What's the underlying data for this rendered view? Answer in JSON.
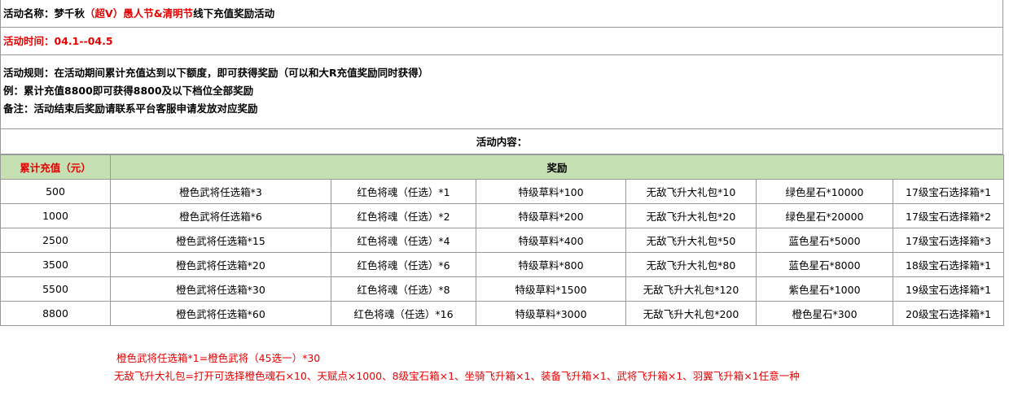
{
  "header": {
    "name_prefix": "活动名称：梦千秋",
    "name_highlight": "（超V）愚人节&清明节",
    "name_suffix": "线下充值奖励活动",
    "time": "活动时间：04.1--04.5"
  },
  "rules": {
    "line1": "活动规则：在活动期间累计充值达到以下额度，即可获得奖励（可以和大R充值奖励同时获得）",
    "line2": "例：累计充值8800即可获得8800及以下档位全部奖励",
    "line3": "备注：活动结束后奖励请联系平台客服申请发放对应奖励"
  },
  "content_label": "活动内容：",
  "table": {
    "col_amount": "累计充值（元）",
    "col_reward": "奖励",
    "rows": [
      {
        "amount": "500",
        "r1": "橙色武将任选箱*3",
        "r2": "红色将魂（任选）*1",
        "r3": "特级草料*100",
        "r4": "无敌飞升大礼包*10",
        "r5": "绿色星石*10000",
        "r6": "17级宝石选择箱*1"
      },
      {
        "amount": "1000",
        "r1": "橙色武将任选箱*6",
        "r2": "红色将魂（任选）*2",
        "r3": "特级草料*200",
        "r4": "无敌飞升大礼包*20",
        "r5": "绿色星石*20000",
        "r6": "17级宝石选择箱*2"
      },
      {
        "amount": "2500",
        "r1": "橙色武将任选箱*15",
        "r2": "红色将魂（任选）*4",
        "r3": "特级草料*400",
        "r4": "无敌飞升大礼包*50",
        "r5": "蓝色星石*5000",
        "r6": "17级宝石选择箱*3"
      },
      {
        "amount": "3500",
        "r1": "橙色武将任选箱*20",
        "r2": "红色将魂（任选）*6",
        "r3": "特级草料*800",
        "r4": "无敌飞升大礼包*80",
        "r5": "蓝色星石*8000",
        "r6": "18级宝石选择箱*1"
      },
      {
        "amount": "5500",
        "r1": "橙色武将任选箱*30",
        "r2": "红色将魂（任选）*8",
        "r3": "特级草料*1500",
        "r4": "无敌飞升大礼包*120",
        "r5": "紫色星石*1000",
        "r6": "19级宝石选择箱*1"
      },
      {
        "amount": "8800",
        "r1": "橙色武将任选箱*60",
        "r2": "红色将魂（任选）*16",
        "r3": "特级草料*3000",
        "r4": "无敌飞升大礼包*200",
        "r5": "橙色星石*300",
        "r6": "20级宝石选择箱*1"
      }
    ]
  },
  "notes": {
    "note1": "橙色武将任选箱*1=橙色武将（45选一）*30",
    "note2": "无敌飞升大礼包=打开可选择橙色魂石×10、天赋点×1000、8级宝石箱×1、坐骑飞升箱×1、装备飞升箱×1、武将飞升箱×1、羽翼飞升箱×1任意一种"
  },
  "colors": {
    "highlight_red": "#e60000",
    "header_green": "#c6e0b4"
  }
}
